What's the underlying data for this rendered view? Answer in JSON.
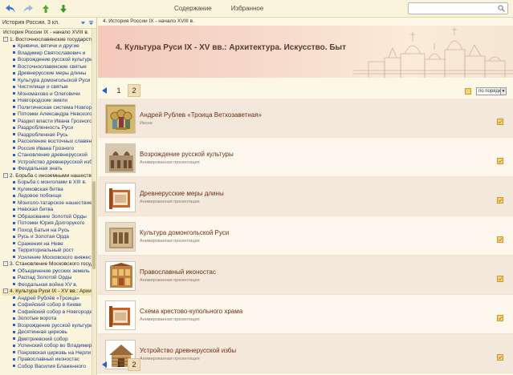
{
  "toolbar": {
    "tabs": [
      "Содержание",
      "Избранное"
    ],
    "search_value": ""
  },
  "sidebar": {
    "header": "История России. 3 кл.",
    "tree": [
      {
        "type": "top",
        "text": "История России IX - начало XVIII в."
      },
      {
        "type": "section",
        "text": "1. Восточнославянские государства",
        "box": "-"
      },
      {
        "type": "sub",
        "text": "Кривичи, вятичи и другие"
      },
      {
        "type": "sub",
        "text": "Владимир Святославович и"
      },
      {
        "type": "sub",
        "text": "Возрождение русской культуры"
      },
      {
        "type": "sub",
        "text": "Восточнославянские святые"
      },
      {
        "type": "sub",
        "text": "Древнерусские меры длины"
      },
      {
        "type": "sub",
        "text": "Культура домонгольской Руси"
      },
      {
        "type": "sub",
        "text": "Чистилище и святые"
      },
      {
        "type": "sub",
        "text": "Мономахово и Олеговичи"
      },
      {
        "type": "sub",
        "text": "Новгородские земли"
      },
      {
        "type": "sub",
        "text": "Политическая система Новгорода"
      },
      {
        "type": "sub",
        "text": "Потомки Александра Невского"
      },
      {
        "type": "sub",
        "text": "Раздел власти Ивана Грозного"
      },
      {
        "type": "sub",
        "text": "Раздробленность Руси"
      },
      {
        "type": "sub",
        "text": "Раздробленная Русь"
      },
      {
        "type": "sub",
        "text": "Расселение восточных славян"
      },
      {
        "type": "sub",
        "text": "Россия Ивана Грозного"
      },
      {
        "type": "sub",
        "text": "Становление древнерусской"
      },
      {
        "type": "sub",
        "text": "Устройство древнерусской избы"
      },
      {
        "type": "sub",
        "text": "Феодальная знать"
      },
      {
        "type": "section",
        "text": "2. Борьба с иноземными нашествиями",
        "box": "-"
      },
      {
        "type": "sub",
        "text": "Борьба с монголами в XIII в."
      },
      {
        "type": "sub",
        "text": "Куликовская битва"
      },
      {
        "type": "sub",
        "text": "Ледовое побоище"
      },
      {
        "type": "sub",
        "text": "Монголо-татарское нашествие"
      },
      {
        "type": "sub",
        "text": "Невская битва"
      },
      {
        "type": "sub",
        "text": "Образование Золотой Орды"
      },
      {
        "type": "sub",
        "text": "Потомки Юрия Долгорукого"
      },
      {
        "type": "sub",
        "text": "Поход Батыя на Русь"
      },
      {
        "type": "sub",
        "text": "Русь и Золотая Орда"
      },
      {
        "type": "sub",
        "text": "Сражения на Неве"
      },
      {
        "type": "sub",
        "text": "Территориальный рост"
      },
      {
        "type": "sub",
        "text": "Усиление Московского княжества"
      },
      {
        "type": "section",
        "text": "3. Становление Московского государства",
        "box": "-"
      },
      {
        "type": "sub",
        "text": "Объединение русских земель"
      },
      {
        "type": "sub",
        "text": "Распад Золотой Орды"
      },
      {
        "type": "sub",
        "text": "Феодальная война XV в."
      },
      {
        "type": "section",
        "text": "4. Культура Руси IX - XV вв.: Архитектура",
        "box": "-",
        "selected": true
      },
      {
        "type": "sub",
        "text": "Андрей Рублёв «Троица»"
      },
      {
        "type": "sub",
        "text": "Софийский собор в Киеве"
      },
      {
        "type": "sub",
        "text": "Софийский собор в Новгороде"
      },
      {
        "type": "sub",
        "text": "Золотые ворота"
      },
      {
        "type": "sub",
        "text": "Возрождение русской культуры"
      },
      {
        "type": "sub",
        "text": "Десятинная церковь"
      },
      {
        "type": "sub",
        "text": "Дмитриевский собор"
      },
      {
        "type": "sub",
        "text": "Успенский собор во Владимире"
      },
      {
        "type": "sub",
        "text": "Покровская церковь на Нерли"
      },
      {
        "type": "sub",
        "text": "Православный иконостас"
      },
      {
        "type": "sub",
        "text": "Собор Василия Блаженного"
      }
    ]
  },
  "main": {
    "breadcrumb": "4. История России IX - начало XVIII в.",
    "banner_title": "4. Культура Руси IX - XV вв.: Архитектура. Искусство. Быт",
    "pages": [
      "1",
      "2"
    ],
    "active_page": "2",
    "sort_label": "по порядку",
    "items": [
      {
        "title": "Андрей Рублев «Троица Ветхозаветная»",
        "subtitle": "Икона",
        "thumb": "icon"
      },
      {
        "title": "Возрождение русской культуры",
        "subtitle": "Анимированная презентация",
        "thumb": "church"
      },
      {
        "title": "Древнерусские меры длины",
        "subtitle": "Анимированная презентация",
        "thumb": "scroll"
      },
      {
        "title": "Культура домонгольской Руси",
        "subtitle": "Анимированная презентация",
        "thumb": "building"
      },
      {
        "title": "Православный иконостас",
        "subtitle": "Анимированная презентация",
        "thumb": "iconostasis"
      },
      {
        "title": "Схема крестово-купольного храма",
        "subtitle": "Анимированная презентация",
        "thumb": "scroll"
      },
      {
        "title": "Устройство древнерусской избы",
        "subtitle": "Анимированная презентация",
        "thumb": "house"
      }
    ]
  },
  "colors": {
    "accent": "#2a5ec9",
    "item_title": "#6b2f12",
    "banner_title": "#5a3b2f",
    "favorite": "#e8b020"
  }
}
